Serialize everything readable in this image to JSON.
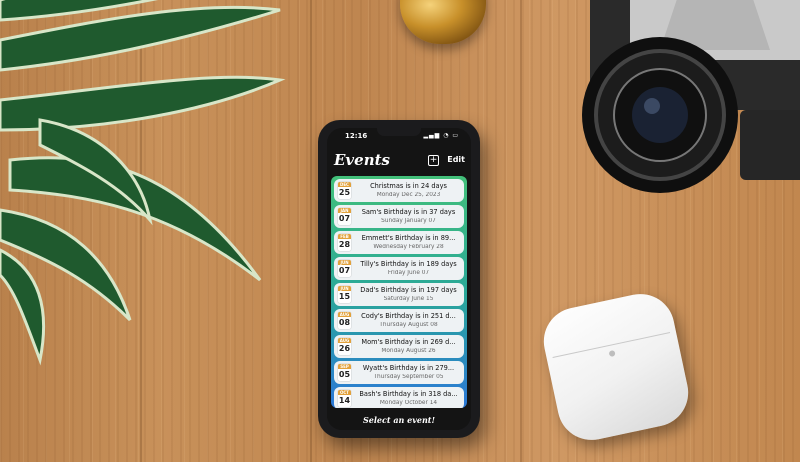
{
  "app": {
    "status_time": "12:16",
    "title": "Events",
    "edit_label": "Edit",
    "add_symbol": "+",
    "footer_text": "Select an event!"
  },
  "events": [
    {
      "month": "DEC",
      "day": "25",
      "title": "Christmas is in 24 days",
      "date": "Monday Dec 25, 2023"
    },
    {
      "month": "JAN",
      "day": "07",
      "title": "Sam's Birthday is in 37 days",
      "date": "Sunday January 07"
    },
    {
      "month": "FEB",
      "day": "28",
      "title": "Emmett's Birthday is in 89...",
      "date": "Wednesday February 28"
    },
    {
      "month": "JUN",
      "day": "07",
      "title": "Tilly's Birthday is in 189 days",
      "date": "Friday June 07"
    },
    {
      "month": "JUN",
      "day": "15",
      "title": "Dad's Birthday is in 197 days",
      "date": "Saturday June 15"
    },
    {
      "month": "AUG",
      "day": "08",
      "title": "Cody's Birthday is in 251 d...",
      "date": "Thursday August 08"
    },
    {
      "month": "AUG",
      "day": "26",
      "title": "Mom's Birthday is in 269 d...",
      "date": "Monday August 26"
    },
    {
      "month": "SEP",
      "day": "05",
      "title": "Wyatt's Birthday is in 279...",
      "date": "Thursday September 05"
    },
    {
      "month": "OCT",
      "day": "14",
      "title": "Bash's Birthday is in 318 da...",
      "date": "Monday October 14"
    }
  ],
  "colors": {
    "list_gradient_top": "#43c07a",
    "list_gradient_bottom": "#2b78d8",
    "calendar_month": "#e2a13a",
    "phone_body": "#1b1b1d",
    "table_wood": "#c28a55"
  }
}
